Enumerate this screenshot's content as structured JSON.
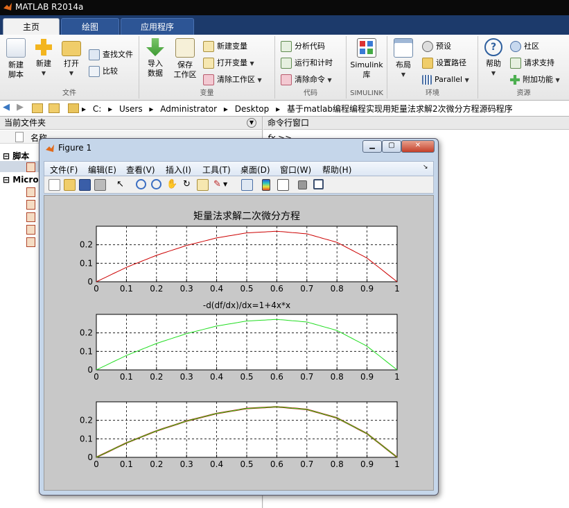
{
  "app": {
    "title": "MATLAB R2014a"
  },
  "tabs": [
    {
      "label": "主页",
      "active": true
    },
    {
      "label": "绘图",
      "active": false
    },
    {
      "label": "应用程序",
      "active": false
    }
  ],
  "ribbon": {
    "file": {
      "group": "文件",
      "new_script": "新建\n脚本",
      "new": "新建",
      "open": "打开",
      "find_files": "查找文件",
      "compare": "比较"
    },
    "variable": {
      "group": "变量",
      "import": "导入\n数据",
      "save": "保存\n工作区",
      "new_var": "新建变量",
      "open_var": "打开变量",
      "clear_ws": "清除工作区"
    },
    "code": {
      "group": "代码",
      "analyze": "分析代码",
      "run_time": "运行和计时",
      "clear_cmd": "清除命令"
    },
    "simulink": {
      "group": "SIMULINK",
      "lib": "Simulink\n库"
    },
    "env": {
      "group": "环境",
      "layout": "布局",
      "prefs": "预设",
      "set_path": "设置路径",
      "parallel": "Parallel"
    },
    "resources": {
      "group": "资源",
      "help": "帮助",
      "community": "社区",
      "support": "请求支持",
      "addons": "附加功能"
    }
  },
  "address": {
    "crumbs": [
      "C:",
      "Users",
      "Administrator",
      "Desktop",
      "基于matlab编程编程实现用矩量法求解2次微分方程源码程序"
    ]
  },
  "left_panel": {
    "title": "当前文件夹",
    "column": "名称",
    "tree": [
      "脚本",
      "Micros"
    ]
  },
  "right_panel": {
    "title": "命令行窗口",
    "prompt": "fx >>"
  },
  "figure": {
    "title": "Figure 1",
    "menu": [
      "文件(F)",
      "编辑(E)",
      "查看(V)",
      "插入(I)",
      "工具(T)",
      "桌面(D)",
      "窗口(W)",
      "帮助(H)"
    ]
  },
  "chart_data": [
    {
      "type": "line",
      "title": "矩量法求解二次微分方程",
      "xlabel": "",
      "ylabel": "",
      "xlim": [
        0,
        1
      ],
      "ylim": [
        0,
        0.3
      ],
      "xticks": [
        "0",
        "0.1",
        "0.2",
        "0.3",
        "0.4",
        "0.5",
        "0.6",
        "0.7",
        "0.8",
        "0.9",
        "1"
      ],
      "yticks": [
        "0",
        "0.1",
        "0.2"
      ],
      "grid": true,
      "series": [
        {
          "color": "#cc0000",
          "x": [
            0,
            0.1,
            0.2,
            0.3,
            0.4,
            0.5,
            0.6,
            0.7,
            0.8,
            0.9,
            1
          ],
          "y": [
            0,
            0.078,
            0.143,
            0.196,
            0.237,
            0.264,
            0.273,
            0.259,
            0.213,
            0.128,
            0
          ]
        }
      ]
    },
    {
      "type": "line",
      "title": "-d(df/dx)/dx=1+4x*x",
      "xlabel": "",
      "ylabel": "",
      "xlim": [
        0,
        1
      ],
      "ylim": [
        0,
        0.3
      ],
      "xticks": [
        "0",
        "0.1",
        "0.2",
        "0.3",
        "0.4",
        "0.5",
        "0.6",
        "0.7",
        "0.8",
        "0.9",
        "1"
      ],
      "yticks": [
        "0",
        "0.1",
        "0.2"
      ],
      "grid": true,
      "series": [
        {
          "color": "#22dd22",
          "x": [
            0,
            0.1,
            0.2,
            0.3,
            0.4,
            0.5,
            0.6,
            0.7,
            0.8,
            0.9,
            1
          ],
          "y": [
            0,
            0.078,
            0.143,
            0.196,
            0.237,
            0.264,
            0.273,
            0.259,
            0.213,
            0.128,
            0
          ]
        }
      ]
    },
    {
      "type": "line",
      "title": "",
      "xlabel": "",
      "ylabel": "",
      "xlim": [
        0,
        1
      ],
      "ylim": [
        0,
        0.3
      ],
      "xticks": [
        "0",
        "0.1",
        "0.2",
        "0.3",
        "0.4",
        "0.5",
        "0.6",
        "0.7",
        "0.8",
        "0.9",
        "1"
      ],
      "yticks": [
        "0",
        "0.1",
        "0.2"
      ],
      "grid": true,
      "series": [
        {
          "color": "#cc0000",
          "x": [
            0,
            0.1,
            0.2,
            0.3,
            0.4,
            0.5,
            0.6,
            0.7,
            0.8,
            0.9,
            1
          ],
          "y": [
            0,
            0.078,
            0.143,
            0.196,
            0.237,
            0.264,
            0.273,
            0.259,
            0.213,
            0.128,
            0
          ]
        },
        {
          "color": "#22dd22",
          "x": [
            0,
            0.1,
            0.2,
            0.3,
            0.4,
            0.5,
            0.6,
            0.7,
            0.8,
            0.9,
            1
          ],
          "y": [
            0,
            0.078,
            0.143,
            0.196,
            0.237,
            0.264,
            0.273,
            0.259,
            0.213,
            0.128,
            0
          ]
        }
      ]
    }
  ]
}
